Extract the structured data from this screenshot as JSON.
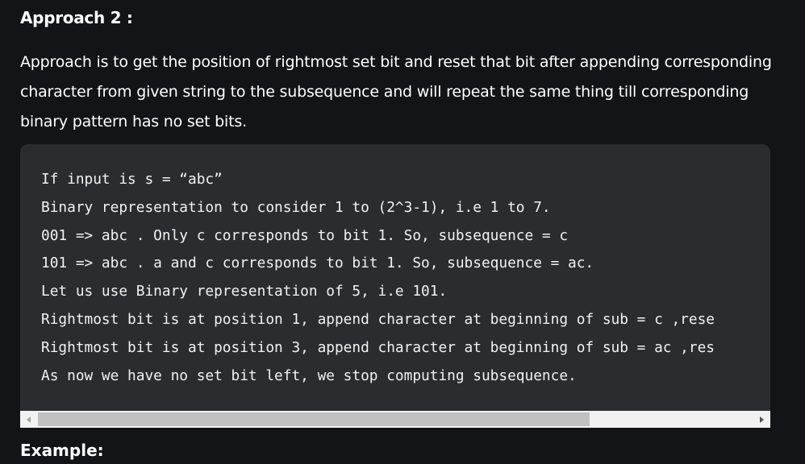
{
  "section": {
    "heading": "Approach 2 :",
    "paragraph": "Approach is to get the position of rightmost set bit and reset that bit after appending corresponding character from given string to the subsequence and will repeat the same thing till corresponding binary pattern has no set bits."
  },
  "code_block": {
    "lines": [
      "If input is s = “abc”",
      "Binary representation to consider 1 to (2^3-1), i.e 1 to 7.",
      "001 => abc . Only c corresponds to bit 1. So, subsequence = c",
      "101 => abc . a and c corresponds to bit 1. So, subsequence = ac.",
      "Let us use Binary representation of 5, i.e 101.",
      "Rightmost bit is at position 1, append character at beginning of sub = c ,rese",
      "Rightmost bit is at position 3, append character at beginning of sub = ac ,res",
      "As now we have no set bit left, we stop computing subsequence."
    ]
  },
  "next_section": {
    "heading": "Example:"
  },
  "icons": {
    "scroll_left": "triangle-left-icon",
    "scroll_right": "triangle-right-icon"
  }
}
